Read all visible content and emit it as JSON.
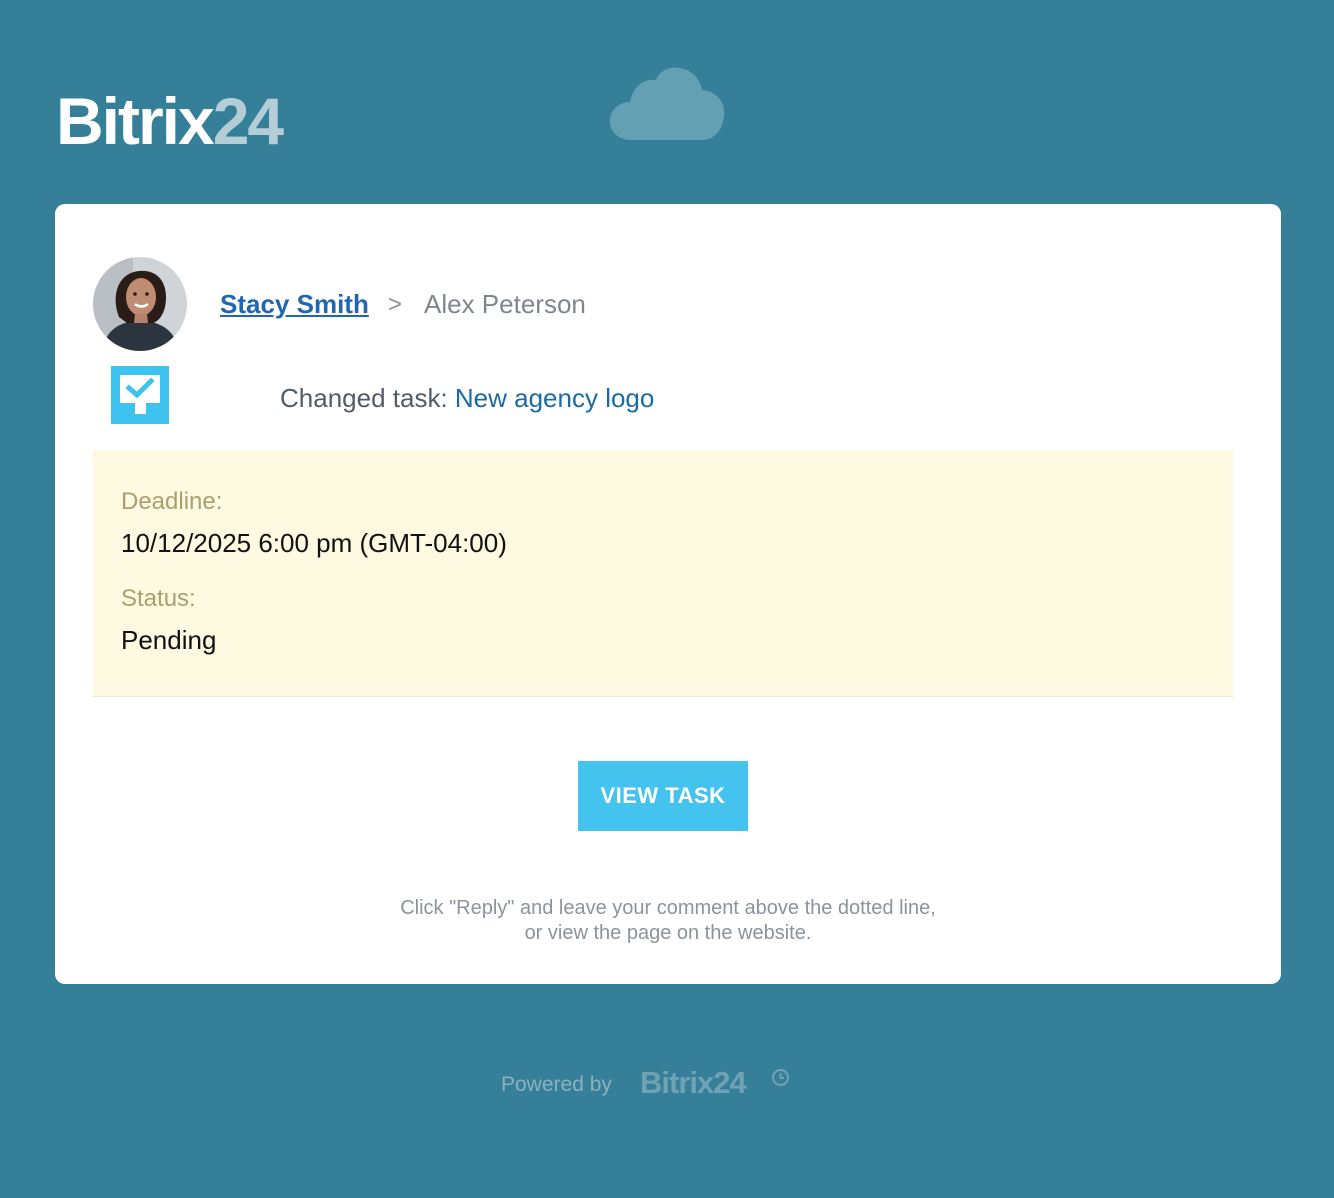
{
  "brand": {
    "name": "Bitrix",
    "number": "24"
  },
  "header": {
    "icon": "cloud-icon"
  },
  "message": {
    "author": "Stacy Smith",
    "separator": ">",
    "recipient": "Alex Peterson",
    "action_text": "Changed task: ",
    "task_title": "New agency logo",
    "task_icon": "task-checkbox-icon"
  },
  "details": {
    "deadline_label": "Deadline:",
    "deadline_value": "10/12/2025 6:00 pm (GMT-04:00)",
    "status_label": "Status:",
    "status_value": "Pending"
  },
  "button": {
    "label": "VIEW TASK"
  },
  "hint": {
    "line1": "Click \"Reply\" and leave your comment above the dotted line,",
    "line2": "or view the page on the website."
  },
  "footer": {
    "powered_by": "Powered by",
    "logo_text": "Bitrix24",
    "logo_icon": "clock-icon"
  },
  "colors": {
    "background": "#357f98",
    "accent": "#45c3ef",
    "link": "#2067b0",
    "info_background": "#fef9e1"
  }
}
